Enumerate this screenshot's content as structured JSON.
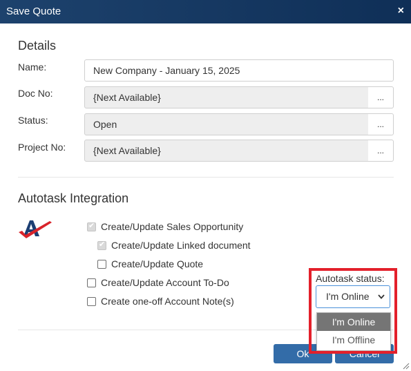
{
  "titlebar": {
    "title": "Save Quote",
    "close": "×"
  },
  "details": {
    "heading": "Details",
    "name_label": "Name:",
    "name_value": "New Company - January 15, 2025",
    "docno_label": "Doc No:",
    "docno_value": "{Next Available}",
    "status_label": "Status:",
    "status_value": "Open",
    "project_label": "Project No:",
    "project_value": "{Next Available}",
    "browse": "..."
  },
  "autotask": {
    "heading": "Autotask Integration",
    "logo_icon": "autotask-logo",
    "checks": [
      {
        "label": "Create/Update Sales Opportunity",
        "checked": true,
        "disabled": true
      },
      {
        "label": "Create/Update Linked document",
        "checked": true,
        "disabled": true
      },
      {
        "label": "Create/Update Quote",
        "checked": false,
        "disabled": false
      },
      {
        "label": "Create/Update Account To-Do",
        "checked": false,
        "disabled": false
      },
      {
        "label": "Create one-off Account Note(s)",
        "checked": false,
        "disabled": false
      }
    ],
    "status_label": "Autotask status:",
    "status_selected": "I'm Online",
    "status_options": [
      "I'm Online",
      "I'm Offline"
    ],
    "highlight_color": "#e3202b"
  },
  "footer": {
    "ok_label": "Ok",
    "cancel_label": "Cancel"
  },
  "colors": {
    "titlebar": "#1d426d",
    "button": "#336ca8"
  }
}
